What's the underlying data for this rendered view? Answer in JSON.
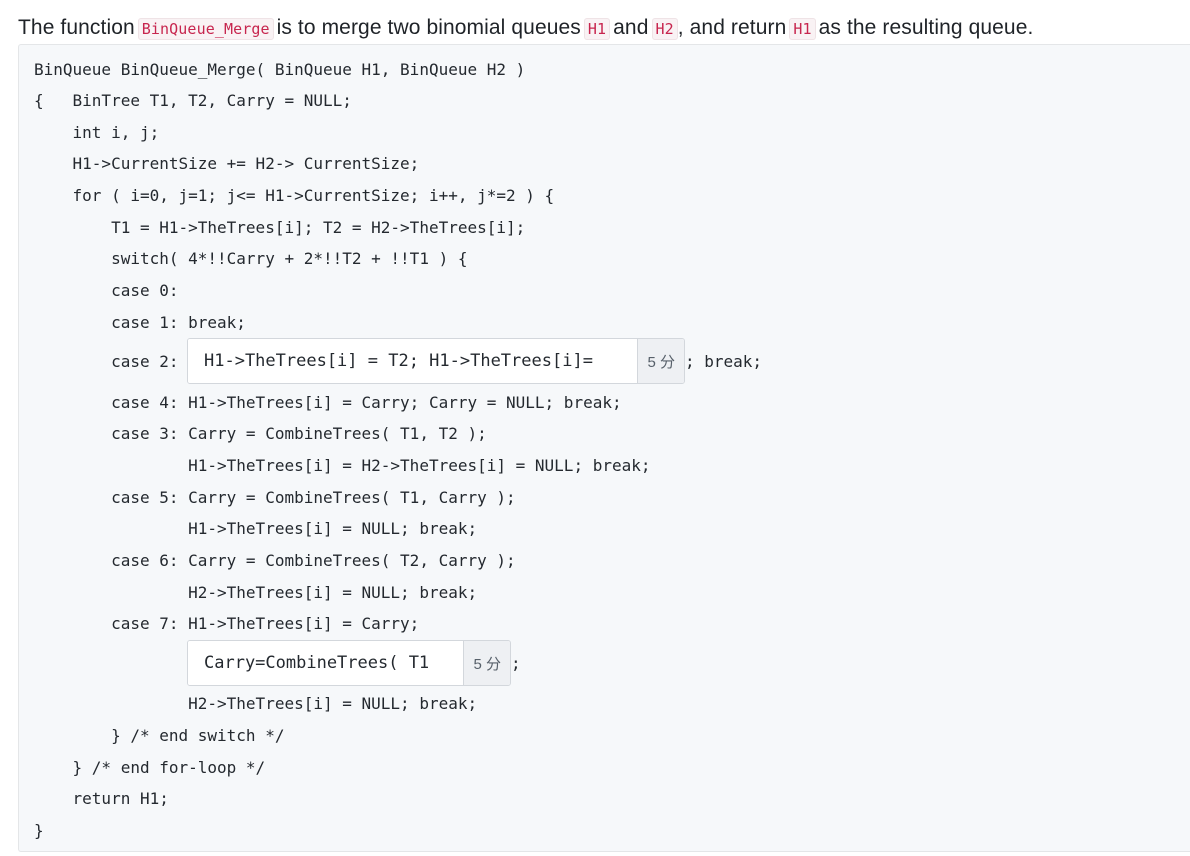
{
  "intro": {
    "t1": "The function",
    "fn": "BinQueue_Merge",
    "t2": "is to merge two binomial queues",
    "h1": "H1",
    "t3": "and",
    "h2": "H2",
    "t4": ", and return",
    "h1b": "H1",
    "t5": "as the resulting queue."
  },
  "code": {
    "l1": "BinQueue BinQueue_Merge( BinQueue H1, BinQueue H2 )",
    "l2": "{   BinTree T1, T2, Carry = NULL;",
    "l3": "    int i, j;",
    "l4": "    H1->CurrentSize += H2-> CurrentSize;",
    "l5": "    for ( i=0, j=1; j<= H1->CurrentSize; i++, j*=2 ) {",
    "l6": "        T1 = H1->TheTrees[i]; T2 = H2->TheTrees[i];",
    "l7": "        switch( 4*!!Carry + 2*!!T2 + !!T1 ) {",
    "l8": "        case 0:",
    "l9": "        case 1: break;",
    "l10_prefix": "        case 2:",
    "l10_suffix": "; break;",
    "l11": "        case 4: H1->TheTrees[i] = Carry; Carry = NULL; break;",
    "l12": "        case 3: Carry = CombineTrees( T1, T2 );",
    "l13": "                H1->TheTrees[i] = H2->TheTrees[i] = NULL; break;",
    "l14": "        case 5: Carry = CombineTrees( T1, Carry );",
    "l15": "                H1->TheTrees[i] = NULL; break;",
    "l16": "        case 6: Carry = CombineTrees( T2, Carry );",
    "l17": "                H2->TheTrees[i] = NULL; break;",
    "l18": "        case 7: H1->TheTrees[i] = Carry;",
    "l19_suffix": ";",
    "l20": "                H2->TheTrees[i] = NULL; break;",
    "l21": "        } /* end switch */",
    "l22": "    } /* end for-loop */",
    "l23": "    return H1;",
    "l24": "}"
  },
  "blanks": {
    "b1": {
      "value": "H1->TheTrees[i] = T2; H1->TheTrees[i]=",
      "score": "5 分"
    },
    "b2": {
      "value": "Carry=CombineTrees( T1",
      "score": "5 分"
    }
  }
}
